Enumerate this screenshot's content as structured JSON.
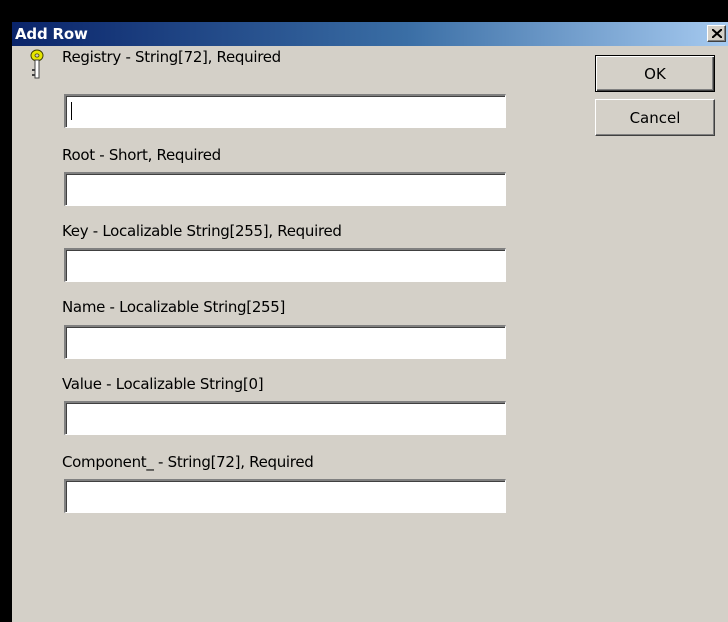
{
  "dialog": {
    "title": "Add Row",
    "close_glyph": "X"
  },
  "fields": [
    {
      "label": "Registry - String[72], Required",
      "value": "",
      "is_key": true,
      "focused": true
    },
    {
      "label": "Root - Short, Required",
      "value": ""
    },
    {
      "label": "Key - Localizable String[255], Required",
      "value": ""
    },
    {
      "label": "Name - Localizable String[255]",
      "value": ""
    },
    {
      "label": "Value - Localizable String[0]",
      "value": ""
    },
    {
      "label": "Component_ - String[72], Required",
      "value": ""
    }
  ],
  "buttons": {
    "ok_label": "OK",
    "cancel_label": "Cancel"
  },
  "icons": {
    "key_field_marker": "key-icon",
    "close": "close-icon"
  },
  "colors": {
    "titlebar_start": "#0a246a",
    "titlebar_end": "#a6caf0",
    "dialog_bg": "#d4d0c8",
    "key_icon": "#e6e600"
  }
}
